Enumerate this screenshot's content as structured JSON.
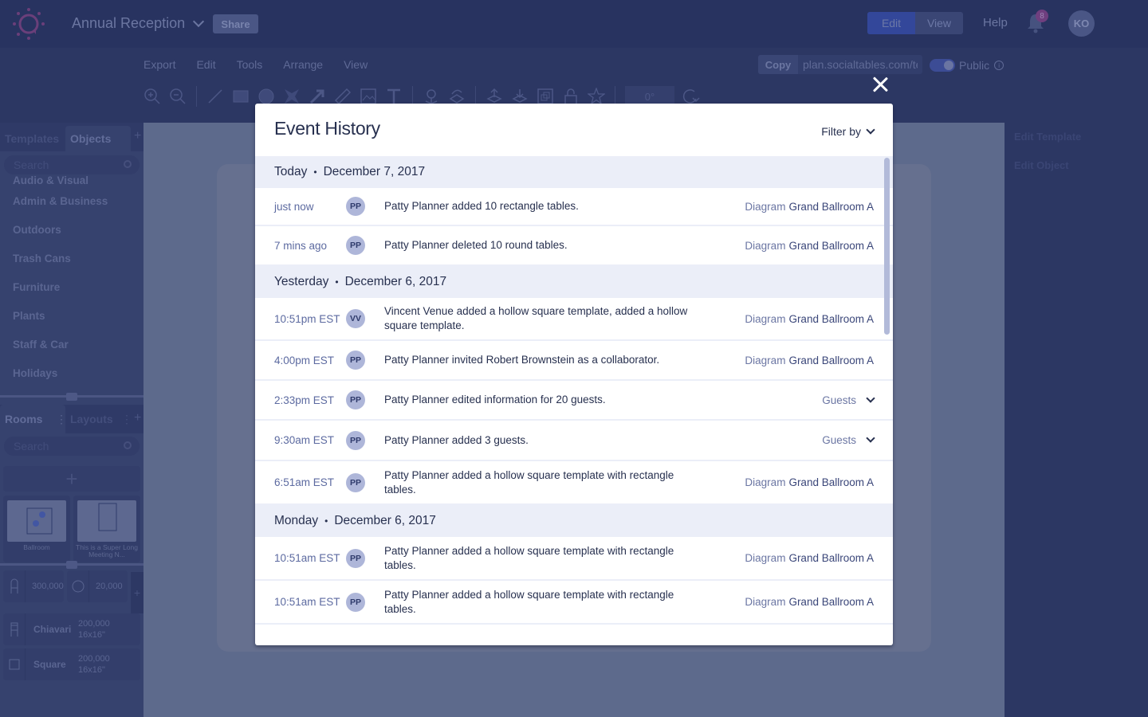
{
  "app": {
    "project_title": "Annual Reception",
    "share_label": "Share",
    "mode_toggle": {
      "edit_label": "Edit",
      "view_label": "View",
      "active": "Edit"
    },
    "help_label": "Help",
    "notifications_count": "8",
    "user_initials": "KO",
    "brand_color": "#7b4a8a",
    "menus": [
      "Export",
      "Edit",
      "Tools",
      "Arrange",
      "View"
    ],
    "copy_label": "Copy",
    "share_url": "plan.socialtables.com/te",
    "public_label": "Public",
    "public_enabled": true,
    "rotation_value": "0°",
    "toolbar_icons": [
      "zoom-in-icon",
      "zoom-out-icon",
      "line-icon",
      "rectangle-icon",
      "circle-icon",
      "star-shape-icon",
      "arrow-icon",
      "ruler-icon",
      "image-icon",
      "text-icon",
      "pin-icon",
      "rotate-floor-icon",
      "bring-forward-icon",
      "send-backward-icon",
      "group-icon",
      "unlock-icon",
      "star-icon",
      "rotate-icon"
    ]
  },
  "left_panel": {
    "tabs": [
      {
        "label": "Templates",
        "active": false
      },
      {
        "label": "Objects",
        "active": true
      }
    ],
    "search_placeholder": "Search",
    "categories": [
      "Audio & Visual",
      "Admin & Business",
      "Outdoors",
      "Trash Cans",
      "Furniture",
      "Plants",
      "Staff & Car",
      "Holidays"
    ],
    "room_tabs": [
      {
        "label": "Rooms",
        "active": true
      },
      {
        "label": "Layouts",
        "active": false
      }
    ],
    "rooms_search_placeholder": "Search",
    "rooms": [
      {
        "name": "Ballroom"
      },
      {
        "name": "This is a Super Long Meeting N..."
      }
    ],
    "counts": {
      "chairs": "300,000",
      "tables": "20,000"
    },
    "items": [
      {
        "name": "Chiavari",
        "count": "200,000",
        "size": "16x16\""
      },
      {
        "name": "Square",
        "count": "200,000",
        "size": "16x16\""
      }
    ]
  },
  "right_panel": {
    "items": [
      "Edit Template",
      "Edit Object"
    ]
  },
  "modal": {
    "title": "Event History",
    "filter_label": "Filter by",
    "close_label": "Close",
    "groups": [
      {
        "day": "Today",
        "date": "December 7, 2017",
        "entries": [
          {
            "time": "just now",
            "initials": "PP",
            "text": "Patty Planner added 10 rectangle tables.",
            "kind": "Diagram",
            "place": "Grand Ballroom A",
            "expandable": false
          },
          {
            "time": "7 mins ago",
            "initials": "PP",
            "text": "Patty Planner deleted 10 round tables.",
            "kind": "Diagram",
            "place": "Grand Ballroom A",
            "expandable": false
          }
        ]
      },
      {
        "day": "Yesterday",
        "date": "December 6, 2017",
        "entries": [
          {
            "time": "10:51pm EST",
            "initials": "VV",
            "text": "Vincent Venue added a hollow square template, added a hollow square template.",
            "kind": "Diagram",
            "place": "Grand Ballroom A",
            "expandable": false
          },
          {
            "time": "4:00pm EST",
            "initials": "PP",
            "text": "Patty Planner invited Robert Brownstein as a collaborator.",
            "kind": "Diagram",
            "place": "Grand Ballroom A",
            "expandable": false
          },
          {
            "time": "2:33pm EST",
            "initials": "PP",
            "text": "Patty Planner edited information for 20 guests.",
            "kind": "Guests",
            "place": "",
            "expandable": true
          },
          {
            "time": "9:30am EST",
            "initials": "PP",
            "text": "Patty Planner added 3 guests.",
            "kind": "Guests",
            "place": "",
            "expandable": true
          },
          {
            "time": "6:51am EST",
            "initials": "PP",
            "text": "Patty Planner added a hollow square template with rectangle tables.",
            "kind": "Diagram",
            "place": "Grand Ballroom A",
            "expandable": false
          }
        ]
      },
      {
        "day": "Monday",
        "date": "December 6, 2017",
        "entries": [
          {
            "time": "10:51am EST",
            "initials": "PP",
            "text": "Patty Planner added a hollow square template with rectangle tables.",
            "kind": "Diagram",
            "place": "Grand Ballroom A",
            "expandable": false
          },
          {
            "time": "10:51am EST",
            "initials": "PP",
            "text": "Patty Planner added a hollow square template with rectangle tables.",
            "kind": "Diagram",
            "place": "Grand Ballroom A",
            "expandable": false
          },
          {
            "time": "",
            "initials": "",
            "text": "",
            "kind": "",
            "place": "",
            "expandable": false
          }
        ]
      }
    ]
  }
}
